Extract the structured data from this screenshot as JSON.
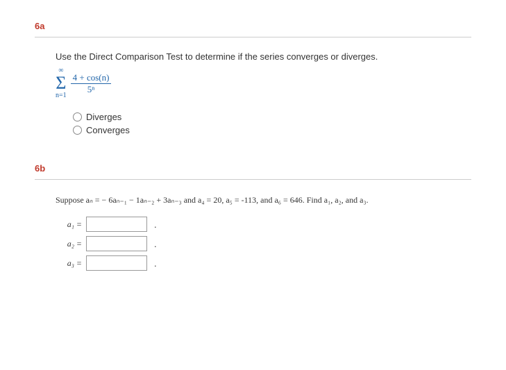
{
  "q6a": {
    "label": "6a",
    "prompt": "Use the Direct Comparison Test to determine if the series converges or diverges.",
    "sigma": {
      "top": "∞",
      "symbol": "Σ",
      "bottom": "n=1"
    },
    "fraction": {
      "numerator": "4 + cos(n)",
      "denominator": "5ⁿ"
    },
    "options": {
      "o1": "Diverges",
      "o2": "Converges"
    }
  },
  "q6b": {
    "label": "6b",
    "recurrence": "Suppose aₙ = − 6aₙ₋₁ − 1aₙ₋₂ + 3aₙ₋₃ and a₄ = 20, a₅ = -113, and a₆ = 646. Find a₁, a₂, and a₃.",
    "rows": {
      "r1": "a₁ =",
      "r2": "a₂ =",
      "r3": "a₃ ="
    },
    "period": "."
  }
}
